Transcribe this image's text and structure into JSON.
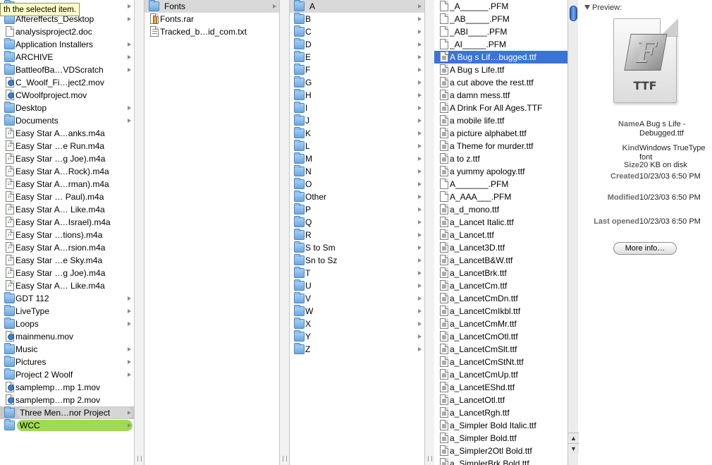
{
  "tooltip": "th the selected item.",
  "column1": {
    "items": [
      {
        "name": "",
        "kind": "folder",
        "arrow": true
      },
      {
        "name": "Aftereffects_Desktop",
        "kind": "folder",
        "arrow": true
      },
      {
        "name": "analysisproject2.doc",
        "kind": "doc",
        "arrow": false
      },
      {
        "name": "Application Installers",
        "kind": "folder",
        "arrow": true
      },
      {
        "name": "ARCHIVE",
        "kind": "folder",
        "arrow": true
      },
      {
        "name": "BattleofBa…VDScratch",
        "kind": "folder",
        "arrow": true
      },
      {
        "name": "C_Woolf_Fi…ject2.mov",
        "kind": "mov",
        "arrow": false
      },
      {
        "name": "CWoolfproject.mov",
        "kind": "mov",
        "arrow": false
      },
      {
        "name": "Desktop",
        "kind": "folder",
        "arrow": true
      },
      {
        "name": "Documents",
        "kind": "folder",
        "arrow": true
      },
      {
        "name": "Easy Star A…anks.m4a",
        "kind": "music",
        "arrow": false
      },
      {
        "name": "Easy Star …e Run.m4a",
        "kind": "music",
        "arrow": false
      },
      {
        "name": "Easy Star …g Joe).m4a",
        "kind": "music",
        "arrow": false
      },
      {
        "name": "Easy Star A…Rock).m4a",
        "kind": "music",
        "arrow": false
      },
      {
        "name": "Easy Star A…rman).m4a",
        "kind": "music",
        "arrow": false
      },
      {
        "name": "Easy Star … Paul).m4a",
        "kind": "music",
        "arrow": false
      },
      {
        "name": "Easy Star A… Like.m4a",
        "kind": "music",
        "arrow": false
      },
      {
        "name": "Easy Star A…Israel).m4a",
        "kind": "music",
        "arrow": false
      },
      {
        "name": "Easy Star …tions).m4a",
        "kind": "music",
        "arrow": false
      },
      {
        "name": "Easy Star A…rsion.m4a",
        "kind": "music",
        "arrow": false
      },
      {
        "name": "Easy Star …e Sky.m4a",
        "kind": "music",
        "arrow": false
      },
      {
        "name": "Easy Star …g Joe).m4a",
        "kind": "music",
        "arrow": false
      },
      {
        "name": "Easy Star A… Like.m4a",
        "kind": "music",
        "arrow": false
      },
      {
        "name": "GDT 112",
        "kind": "folder",
        "arrow": true
      },
      {
        "name": "LiveType",
        "kind": "folder",
        "arrow": true
      },
      {
        "name": "Loops",
        "kind": "folder",
        "arrow": true
      },
      {
        "name": "mainmenu.mov",
        "kind": "mov",
        "arrow": false
      },
      {
        "name": "Music",
        "kind": "folder",
        "arrow": true
      },
      {
        "name": "Pictures",
        "kind": "folder",
        "arrow": true
      },
      {
        "name": "Project 2 Woolf",
        "kind": "folder",
        "arrow": true
      },
      {
        "name": "samplemp…mp 1.mov",
        "kind": "mov",
        "arrow": false
      },
      {
        "name": "samplemp…mp 2.mov",
        "kind": "mov",
        "arrow": false
      },
      {
        "name": "Three Men…nor Project",
        "kind": "folder",
        "arrow": true,
        "state": "gray"
      },
      {
        "name": "WCC",
        "kind": "folder",
        "arrow": true,
        "state": "green"
      }
    ]
  },
  "column2": {
    "items": [
      {
        "name": "Fonts",
        "kind": "folder",
        "arrow": true,
        "state": "path"
      },
      {
        "name": "Fonts.rar",
        "kind": "rar",
        "arrow": false
      },
      {
        "name": "Tracked_b…id_com.txt",
        "kind": "txt",
        "arrow": false
      }
    ]
  },
  "column3": {
    "items": [
      {
        "name": "A",
        "state": "path"
      },
      {
        "name": "B"
      },
      {
        "name": "C"
      },
      {
        "name": "D"
      },
      {
        "name": "E"
      },
      {
        "name": "F"
      },
      {
        "name": "G"
      },
      {
        "name": "H"
      },
      {
        "name": "I"
      },
      {
        "name": "J"
      },
      {
        "name": "K"
      },
      {
        "name": "L"
      },
      {
        "name": "M"
      },
      {
        "name": "N"
      },
      {
        "name": "O"
      },
      {
        "name": "Other"
      },
      {
        "name": "P"
      },
      {
        "name": "Q"
      },
      {
        "name": "R"
      },
      {
        "name": "S to Sm"
      },
      {
        "name": "Sn to Sz"
      },
      {
        "name": "T"
      },
      {
        "name": "U"
      },
      {
        "name": "V"
      },
      {
        "name": "W"
      },
      {
        "name": "X"
      },
      {
        "name": "Y"
      },
      {
        "name": "Z"
      }
    ]
  },
  "column4": {
    "items": [
      {
        "name": "_A______.PFM",
        "kind": "doc"
      },
      {
        "name": "_AB_____.PFM",
        "kind": "doc"
      },
      {
        "name": "_ABI____.PFM",
        "kind": "doc"
      },
      {
        "name": "_AI_____.PFM",
        "kind": "doc"
      },
      {
        "name": "A Bug s Lif…bugged.ttf",
        "kind": "ttf",
        "state": "selected"
      },
      {
        "name": "A Bug s Life.ttf",
        "kind": "ttf"
      },
      {
        "name": "a cut above the rest.ttf",
        "kind": "ttf"
      },
      {
        "name": "a damn mess.ttf",
        "kind": "ttf"
      },
      {
        "name": "A Drink For All Ages.TTF",
        "kind": "ttf"
      },
      {
        "name": "a mobile life.ttf",
        "kind": "ttf"
      },
      {
        "name": "a picture alphabet.ttf",
        "kind": "ttf"
      },
      {
        "name": "a Theme for murder.ttf",
        "kind": "ttf"
      },
      {
        "name": "a to z.ttf",
        "kind": "ttf"
      },
      {
        "name": "a yummy apology.ttf",
        "kind": "ttf"
      },
      {
        "name": "A_______.PFM",
        "kind": "doc"
      },
      {
        "name": "A_AAA___.PFM",
        "kind": "doc"
      },
      {
        "name": "a_d_mono.ttf",
        "kind": "ttf"
      },
      {
        "name": "a_Lancet Italic.ttf",
        "kind": "ttf"
      },
      {
        "name": "a_Lancet.ttf",
        "kind": "ttf"
      },
      {
        "name": "a_Lancet3D.ttf",
        "kind": "ttf"
      },
      {
        "name": "a_LancetB&W.ttf",
        "kind": "ttf"
      },
      {
        "name": "a_LancetBrk.ttf",
        "kind": "ttf"
      },
      {
        "name": "a_LancetCm.ttf",
        "kind": "ttf"
      },
      {
        "name": "a_LancetCmDn.ttf",
        "kind": "ttf"
      },
      {
        "name": "a_LancetCmIkbl.ttf",
        "kind": "ttf"
      },
      {
        "name": "a_LancetCmMr.ttf",
        "kind": "ttf"
      },
      {
        "name": "a_LancetCmOtl.ttf",
        "kind": "ttf"
      },
      {
        "name": "a_LancetCmSlt.ttf",
        "kind": "ttf"
      },
      {
        "name": "a_LancetCmStNt.ttf",
        "kind": "ttf"
      },
      {
        "name": "a_LancetCmUp.ttf",
        "kind": "ttf"
      },
      {
        "name": "a_LancetEShd.ttf",
        "kind": "ttf"
      },
      {
        "name": "a_LancetOtl.ttf",
        "kind": "ttf"
      },
      {
        "name": "a_LancetRgh.ttf",
        "kind": "ttf"
      },
      {
        "name": "a_Simpler Bold Italic.ttf",
        "kind": "ttf"
      },
      {
        "name": "a_Simpler Bold.ttf",
        "kind": "ttf"
      },
      {
        "name": "a_Simpler2Otl Bold.ttf",
        "kind": "ttf"
      },
      {
        "name": "a_SimplerBrk Bold.ttf",
        "kind": "ttf"
      }
    ]
  },
  "preview": {
    "heading": "Preview:",
    "icon_label": "TTF",
    "icon_letter": "F",
    "more_info": "More info…",
    "fields": [
      {
        "key": "Name",
        "value": "A Bug s Life - Debugged.ttf"
      },
      {
        "key": "Kind",
        "value": "Windows TrueType font"
      },
      {
        "key": "Size",
        "value": "20 KB on disk"
      },
      {
        "key": "Created",
        "value": "10/23/03 6:50 PM"
      },
      {
        "key": "Modified",
        "value": "10/23/03 6:50 PM"
      },
      {
        "key": "Last opened",
        "value": "10/23/03 6:50 PM"
      }
    ]
  },
  "colors": {
    "selection": "#3875d7",
    "label_green": "#9fdb52",
    "folder": "#6da7e0"
  }
}
